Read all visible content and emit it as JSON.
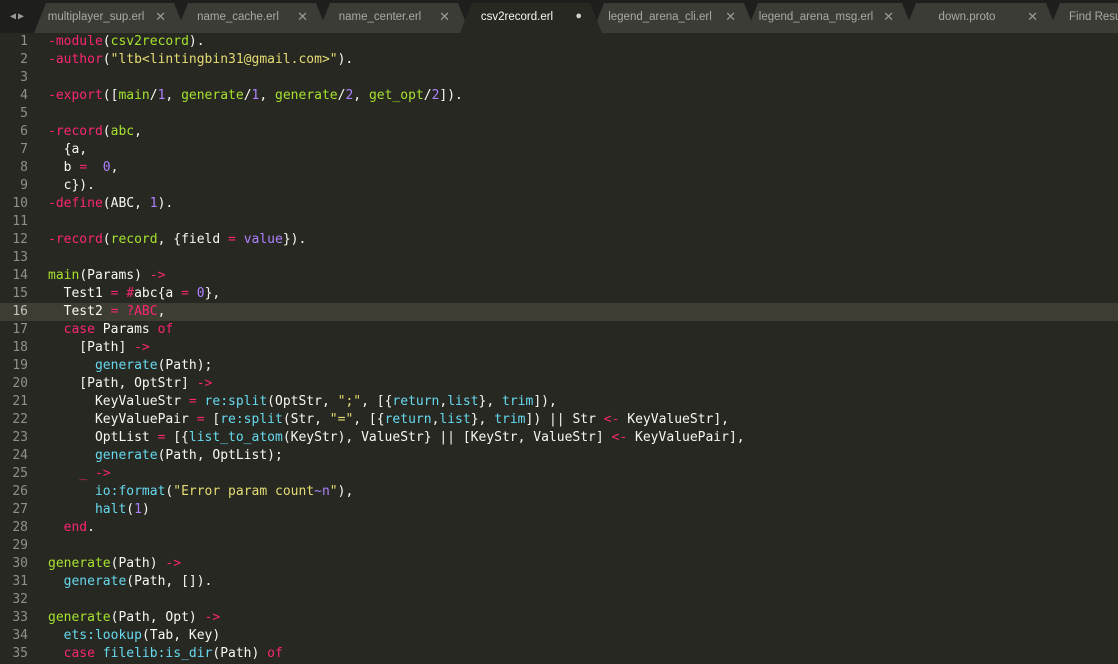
{
  "nav": {
    "back_icon": "◀",
    "forward_icon": "▶"
  },
  "tabs": [
    {
      "label": "multiplayer_sup.erl",
      "close": "✕"
    },
    {
      "label": "name_cache.erl",
      "close": "✕"
    },
    {
      "label": "name_center.erl",
      "close": "✕"
    },
    {
      "label": "csv2record.erl",
      "close": "●"
    },
    {
      "label": "legend_arena_cli.erl",
      "close": "✕"
    },
    {
      "label": "legend_arena_msg.erl",
      "close": "✕"
    },
    {
      "label": "down.proto",
      "close": "✕"
    },
    {
      "label": "Find Results",
      "close": ""
    }
  ],
  "active_tab": 3,
  "current_line": 16,
  "colors": {
    "background": "#272822",
    "tabbar": "#1e1f1c",
    "keyword": "#f92672",
    "function": "#a6e22e",
    "string": "#e6db74",
    "number": "#ae81ff",
    "builtin": "#66d9ef"
  },
  "editor": {
    "lines": [
      {
        "n": "1",
        "t": [
          [
            "k",
            "-module"
          ],
          [
            "",
            "("
          ],
          [
            "f",
            "csv2record"
          ],
          [
            "",
            "). "
          ]
        ]
      },
      {
        "n": "2",
        "t": [
          [
            "k",
            "-author"
          ],
          [
            "",
            "("
          ],
          [
            "s",
            "\"ltb<lintingbin31@gmail.com>\""
          ],
          [
            "",
            ")."
          ]
        ]
      },
      {
        "n": "3",
        "t": []
      },
      {
        "n": "4",
        "t": [
          [
            "k",
            "-export"
          ],
          [
            "",
            "(["
          ],
          [
            "f",
            "main"
          ],
          [
            "",
            "/"
          ],
          [
            "n",
            "1"
          ],
          [
            "",
            ", "
          ],
          [
            "f",
            "generate"
          ],
          [
            "",
            "/"
          ],
          [
            "n",
            "1"
          ],
          [
            "",
            ", "
          ],
          [
            "f",
            "generate"
          ],
          [
            "",
            "/"
          ],
          [
            "n",
            "2"
          ],
          [
            "",
            ", "
          ],
          [
            "f",
            "get_opt"
          ],
          [
            "",
            "/"
          ],
          [
            "n",
            "2"
          ],
          [
            "",
            "])."
          ]
        ]
      },
      {
        "n": "5",
        "t": []
      },
      {
        "n": "6",
        "t": [
          [
            "k",
            "-record"
          ],
          [
            "",
            "("
          ],
          [
            "f",
            "abc"
          ],
          [
            "",
            ","
          ]
        ]
      },
      {
        "n": "7",
        "t": [
          [
            "",
            "  {a,"
          ]
        ]
      },
      {
        "n": "8",
        "t": [
          [
            "",
            "  b "
          ],
          [
            "k",
            "="
          ],
          [
            "",
            "  "
          ],
          [
            "n",
            "0"
          ],
          [
            "",
            ","
          ]
        ]
      },
      {
        "n": "9",
        "t": [
          [
            "",
            "  c})."
          ]
        ]
      },
      {
        "n": "10",
        "t": [
          [
            "k",
            "-define"
          ],
          [
            "",
            "(ABC, "
          ],
          [
            "n",
            "1"
          ],
          [
            "",
            ")."
          ]
        ]
      },
      {
        "n": "11",
        "t": []
      },
      {
        "n": "12",
        "t": [
          [
            "k",
            "-record"
          ],
          [
            "",
            "("
          ],
          [
            "f",
            "record"
          ],
          [
            "",
            ", {field "
          ],
          [
            "k",
            "="
          ],
          [
            "",
            ""
          ],
          [
            "n",
            " value"
          ],
          [
            "",
            "})."
          ]
        ]
      },
      {
        "n": "13",
        "t": []
      },
      {
        "n": "14",
        "t": [
          [
            "f",
            "main"
          ],
          [
            "",
            "(Params) "
          ],
          [
            "k",
            "->"
          ]
        ]
      },
      {
        "n": "15",
        "t": [
          [
            "",
            "  Test1 "
          ],
          [
            "k",
            "="
          ],
          [
            "",
            ""
          ],
          [
            "k",
            " #"
          ],
          [
            "",
            "abc{a "
          ],
          [
            "k",
            "="
          ],
          [
            "",
            ""
          ],
          [
            "n",
            " 0"
          ],
          [
            "",
            "},"
          ]
        ]
      },
      {
        "n": "16",
        "t": [
          [
            "",
            "  Test2 "
          ],
          [
            "k",
            "="
          ],
          [
            "",
            ""
          ],
          [
            "k",
            " ?"
          ],
          [
            "k",
            "ABC"
          ],
          [
            "",
            ","
          ]
        ]
      },
      {
        "n": "17",
        "t": [
          [
            "",
            "  "
          ],
          [
            "k",
            "case"
          ],
          [
            "",
            ""
          ],
          [
            "",
            ""
          ],
          [
            "",
            " Params "
          ],
          [
            "k",
            "of"
          ]
        ]
      },
      {
        "n": "18",
        "t": [
          [
            "",
            "    [Path] "
          ],
          [
            "k",
            "->"
          ]
        ]
      },
      {
        "n": "19",
        "t": [
          [
            "",
            "      "
          ],
          [
            "c",
            "generate"
          ],
          [
            "",
            "(Path);"
          ]
        ]
      },
      {
        "n": "20",
        "t": [
          [
            "",
            "    [Path, OptStr] "
          ],
          [
            "k",
            "->"
          ]
        ]
      },
      {
        "n": "21",
        "t": [
          [
            "",
            "      KeyValueStr "
          ],
          [
            "k",
            "="
          ],
          [
            "",
            ""
          ],
          [
            "c",
            " re:split"
          ],
          [
            "",
            "(OptStr, "
          ],
          [
            "s",
            "\";\""
          ],
          [
            "",
            ", [{"
          ],
          [
            "c",
            "return"
          ],
          [
            "",
            ","
          ],
          [
            "c",
            "list"
          ],
          [
            "",
            "}, "
          ],
          [
            "c",
            "trim"
          ],
          [
            "",
            "]),"
          ]
        ]
      },
      {
        "n": "22",
        "t": [
          [
            "",
            "      KeyValuePair "
          ],
          [
            "k",
            "="
          ],
          [
            "",
            ""
          ],
          [
            "",
            " ["
          ],
          [
            "c",
            "re:split"
          ],
          [
            "",
            "(Str, "
          ],
          [
            "s",
            "\"=\""
          ],
          [
            "",
            ", [{"
          ],
          [
            "c",
            "return"
          ],
          [
            "",
            ","
          ],
          [
            "c",
            "list"
          ],
          [
            "",
            "}, "
          ],
          [
            "c",
            "trim"
          ],
          [
            "",
            "]) || Str "
          ],
          [
            "k",
            "<-"
          ],
          [
            "",
            ""
          ],
          [
            "",
            " KeyValueStr],"
          ]
        ]
      },
      {
        "n": "23",
        "t": [
          [
            "",
            "      OptList "
          ],
          [
            "k",
            "="
          ],
          [
            "",
            ""
          ],
          [
            "",
            " [{"
          ],
          [
            "c",
            "list_to_atom"
          ],
          [
            "",
            "(KeyStr), ValueStr} || [KeyStr, ValueStr] "
          ],
          [
            "k",
            "<-"
          ],
          [
            "",
            ""
          ],
          [
            "",
            " KeyValuePair],"
          ]
        ]
      },
      {
        "n": "24",
        "t": [
          [
            "",
            "      "
          ],
          [
            "c",
            "generate"
          ],
          [
            "",
            "(Path, OptList);"
          ]
        ]
      },
      {
        "n": "25",
        "t": [
          [
            "",
            "    "
          ],
          [
            "k",
            "_"
          ],
          [
            "",
            ""
          ],
          [
            "",
            " "
          ],
          [
            "k",
            "->"
          ]
        ]
      },
      {
        "n": "26",
        "t": [
          [
            "",
            "      "
          ],
          [
            "c",
            "io:format"
          ],
          [
            "",
            "("
          ],
          [
            "s",
            "\"Error param count"
          ],
          [
            "n",
            "~n"
          ],
          [
            "s",
            "\""
          ],
          [
            "",
            "),"
          ]
        ]
      },
      {
        "n": "27",
        "t": [
          [
            "",
            "      "
          ],
          [
            "c",
            "halt"
          ],
          [
            "",
            "("
          ],
          [
            "n",
            "1"
          ],
          [
            "",
            ")"
          ]
        ]
      },
      {
        "n": "28",
        "t": [
          [
            "",
            "  "
          ],
          [
            "k",
            "end"
          ],
          [
            "",
            "."
          ]
        ]
      },
      {
        "n": "29",
        "t": []
      },
      {
        "n": "30",
        "t": [
          [
            "f",
            "generate"
          ],
          [
            "",
            "(Path) "
          ],
          [
            "k",
            "->"
          ]
        ]
      },
      {
        "n": "31",
        "t": [
          [
            "",
            "  "
          ],
          [
            "c",
            "generate"
          ],
          [
            "",
            "(Path, [])."
          ]
        ]
      },
      {
        "n": "32",
        "t": []
      },
      {
        "n": "33",
        "t": [
          [
            "f",
            "generate"
          ],
          [
            "",
            "(Path, Opt) "
          ],
          [
            "k",
            "->"
          ]
        ]
      },
      {
        "n": "34",
        "t": [
          [
            "",
            "  "
          ],
          [
            "c",
            "ets:lookup"
          ],
          [
            "",
            "(Tab, Key)"
          ]
        ]
      },
      {
        "n": "35",
        "t": [
          [
            "",
            "  "
          ],
          [
            "k",
            "case"
          ],
          [
            "",
            ""
          ],
          [
            "",
            " "
          ],
          [
            "c",
            "filelib:is_dir"
          ],
          [
            "",
            "(Path) "
          ],
          [
            "k",
            "of"
          ]
        ]
      }
    ]
  }
}
